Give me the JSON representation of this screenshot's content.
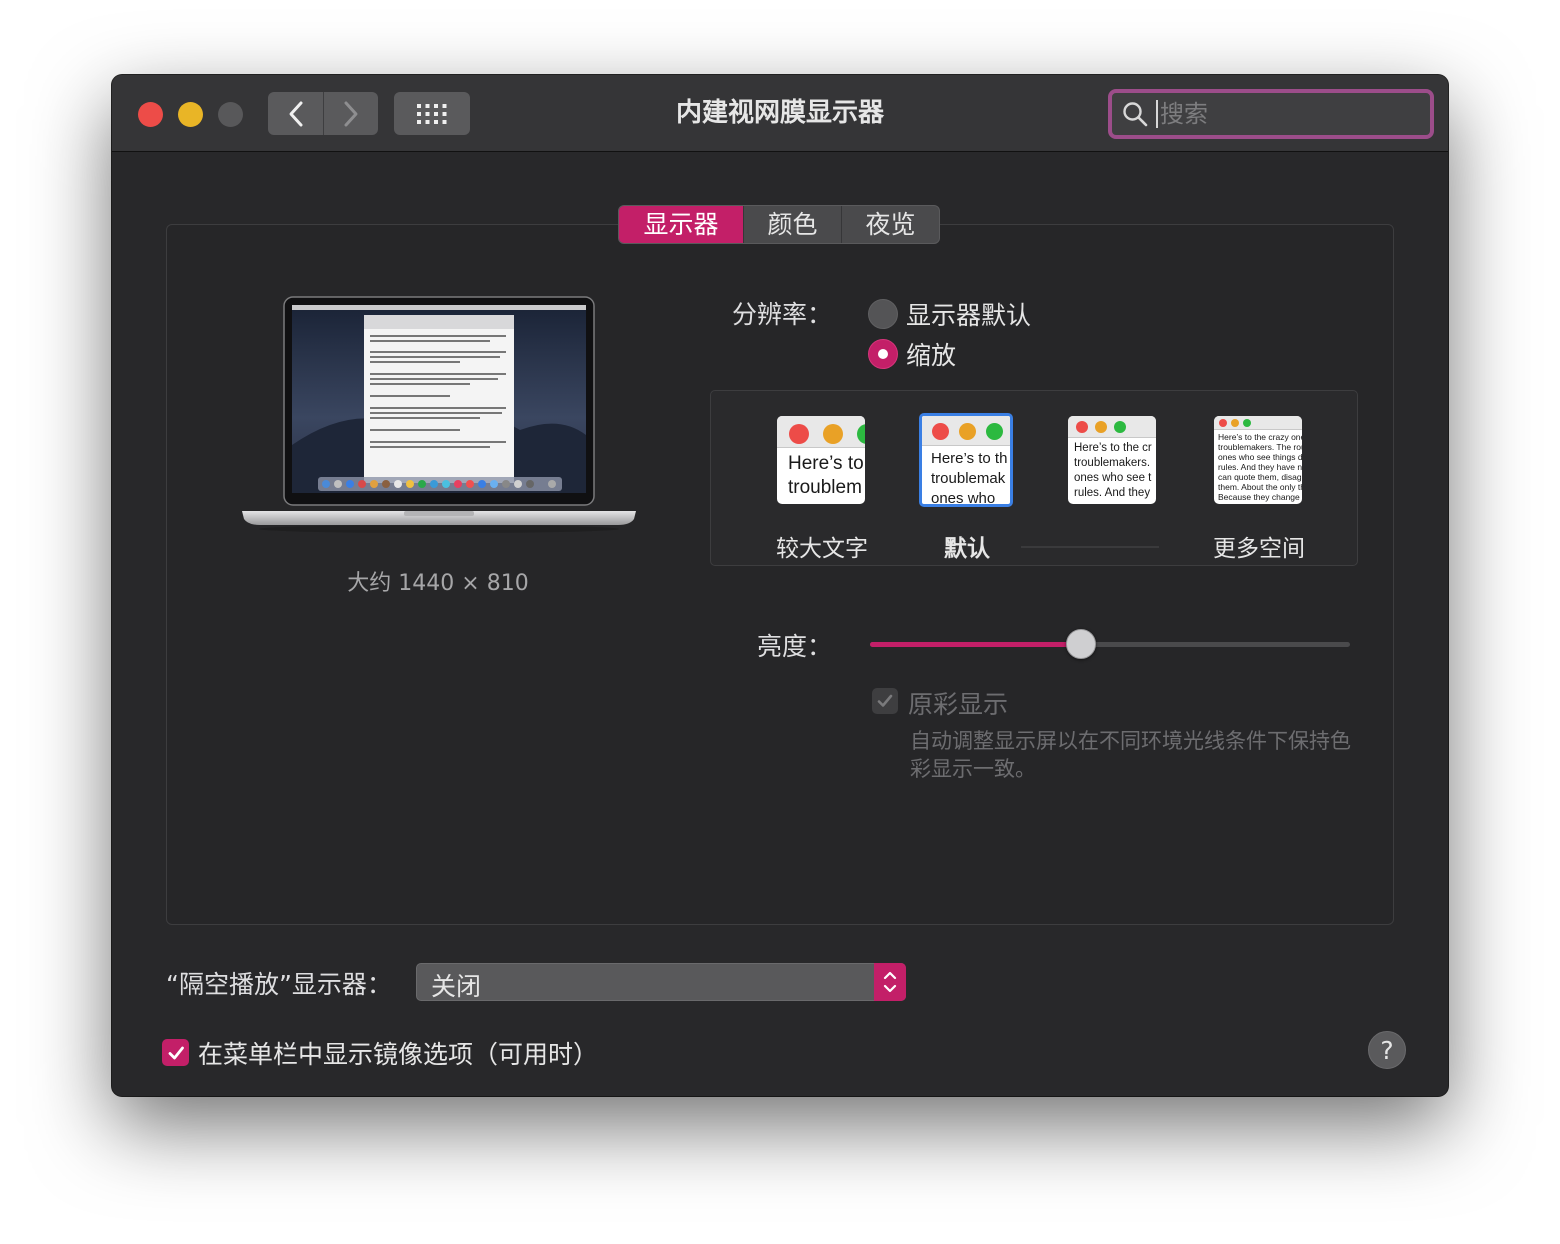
{
  "window": {
    "title": "内建视网膜显示器"
  },
  "search": {
    "placeholder": "搜索"
  },
  "tabs": [
    {
      "label": "显示器",
      "active": true
    },
    {
      "label": "颜色",
      "active": false
    },
    {
      "label": "夜览",
      "active": false
    }
  ],
  "display": {
    "approx_resolution": "大约 1440 × 810"
  },
  "resolution": {
    "label": "分辨率：",
    "options": [
      {
        "label": "显示器默认",
        "selected": false
      },
      {
        "label": "缩放",
        "selected": true
      }
    ]
  },
  "scaling": {
    "options": [
      {
        "label": "较大文字",
        "preview_line1": "Here’s to",
        "preview_line2": "troublem",
        "selected": false
      },
      {
        "label": "默认",
        "preview_line1": "Here’s to th",
        "preview_line2": "troublemak",
        "preview_line3": "ones who",
        "selected": true
      },
      {
        "label": "",
        "preview_line1": "Here’s to the cr",
        "preview_line2": "troublemakers.",
        "preview_line3": "ones who see t",
        "preview_line4": "rules. And they",
        "selected": false
      },
      {
        "label": "更多空间",
        "preview_line1": "Here’s to the crazy one",
        "preview_line2": "troublemakers. The rou",
        "preview_line3": "ones who see things dif",
        "preview_line4": "rules. And they have no",
        "preview_line5": "can quote them, disagr",
        "preview_line6": "them. About the only th",
        "preview_line7": "Because they change t",
        "selected": false
      }
    ]
  },
  "brightness": {
    "label": "亮度：",
    "level": 0.44
  },
  "true_tone": {
    "label": "原彩显示",
    "checked": true,
    "enabled": false,
    "description": "自动调整显示屏以在不同环境光线条件下保持色彩显示一致。"
  },
  "airplay": {
    "label": "“隔空播放”显示器：",
    "value": "关闭"
  },
  "mirroring": {
    "label": "在菜单栏中显示镜像选项（可用时）",
    "checked": true
  },
  "help": {
    "label": "?"
  },
  "colors": {
    "accent": "#c31f68",
    "window_bg": "#28282a",
    "titlebar_bg": "#353537",
    "close": "#ed4c48",
    "minimize": "#e9b526",
    "selection_ring": "#3a7fe4"
  }
}
